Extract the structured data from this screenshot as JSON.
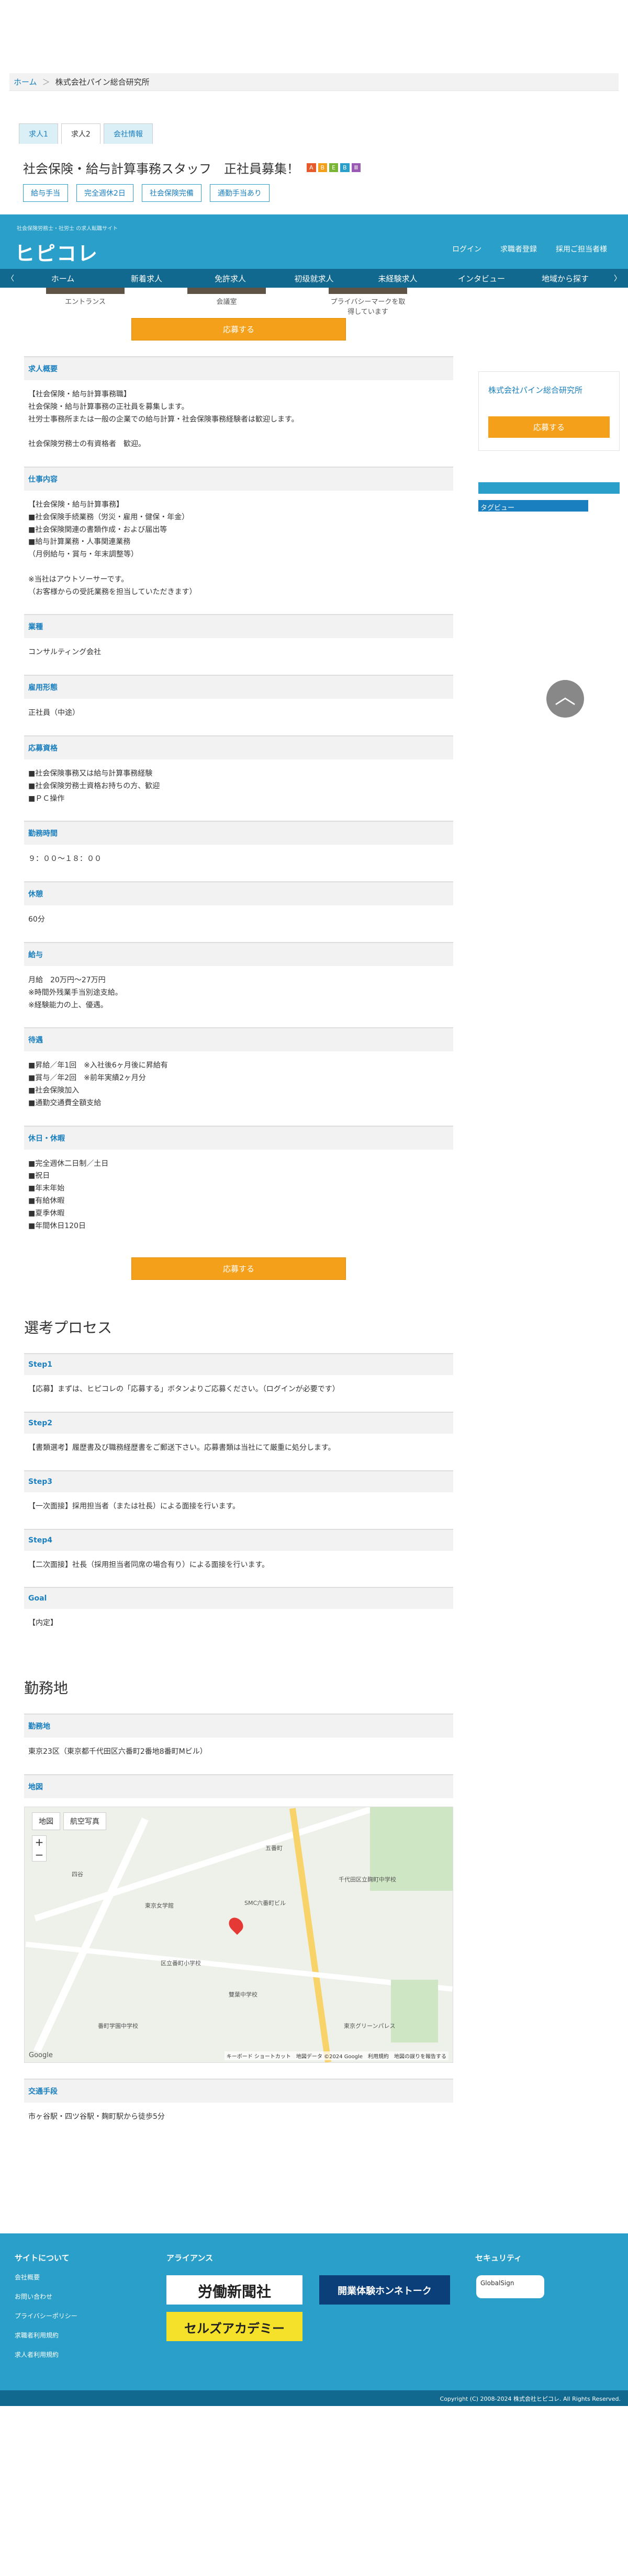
{
  "breadcrumb": {
    "home": "ホーム",
    "sep": "＞",
    "current": "株式会社パイン総合研究所"
  },
  "tabs": [
    "求人1",
    "求人2",
    "会社情報"
  ],
  "job": {
    "title": "社会保険・給与計算事務スタッフ　正社員募集！",
    "badges": [
      {
        "label": "A",
        "color": "#e65a2b"
      },
      {
        "label": "B",
        "color": "#f5a01a"
      },
      {
        "label": "E",
        "color": "#7bb536"
      },
      {
        "label": "B",
        "color": "#2a9fc9"
      },
      {
        "label": "Ⅲ",
        "color": "#9b59b6"
      }
    ],
    "tags": [
      "給与手当",
      "完全週休2日",
      "社会保険完備",
      "通勤手当あり"
    ]
  },
  "header": {
    "tagline": "社会保険労務士・社労士 の求人転職サイト",
    "logo": "ヒピコレ",
    "links": [
      "ログイン",
      "求職者登録",
      "採用ご担当者様"
    ]
  },
  "nav": {
    "prev": "〈",
    "next": "〉",
    "items": [
      "ホーム",
      "新着求人",
      "免許求人",
      "初级就求人",
      "未経験求人",
      "インタビュー",
      "地域から探す"
    ]
  },
  "photos": [
    "エントランス",
    "会議室",
    "プライバシーマークを取得しています"
  ],
  "apply_label": "応募する",
  "sections": [
    {
      "head": "求人概要",
      "body": "【社会保険・給与計算事務職】\n社会保険・給与計算事務の正社員を募集します。\n社労士事務所または一般の企業での給与計算・社会保険事務経験者は歓迎します。\n\n社会保険労務士の有資格者　歓迎。"
    },
    {
      "head": "仕事内容",
      "body": "【社会保険・給与計算事務】\n■社会保険手続業務（労災・雇用・健保・年金）\n■社会保険関連の書類作成・および届出等\n■給与計算業務・人事関連業務\n（月例給与・賞与・年末調整等）\n\n※当社はアウトソーサーです。\n（お客様からの受託業務を担当していただきます）"
    },
    {
      "head": "業種",
      "body": "コンサルティング会社"
    },
    {
      "head": "雇用形態",
      "body": "正社員（中途）"
    },
    {
      "head": "応募資格",
      "body": "■社会保険事務又は給与計算事務経験\n■社会保険労務士資格お持ちの方、歓迎\n■ＰＣ操作"
    },
    {
      "head": "勤務時間",
      "body": "９：００〜１８：００"
    },
    {
      "head": "休憩",
      "body": "60分"
    },
    {
      "head": "給与",
      "body": "月給　20万円〜27万円\n※時間外残業手当別途支給。\n※経験能力の上、優遇。"
    },
    {
      "head": "待遇",
      "body": "■昇給／年1回　※入社後6ヶ月後に昇給有\n■賞与／年2回　※前年実績2ヶ月分\n■社会保険加入\n■通勤交通費全額支給"
    },
    {
      "head": "休日・休暇",
      "body": "■完全週休二日制／土日\n■祝日\n■年末年始\n■有給休暇\n■夏季休暇\n■年間休日120日"
    }
  ],
  "selection": {
    "title": "選考プロセス",
    "steps": [
      {
        "head": "Step1",
        "body": "【応募】まずは、ヒピコレの「応募する」ボタンよりご応募ください。（ログインが必要です）"
      },
      {
        "head": "Step2",
        "body": "【書類選考】履歴書及び職務経歴書をご郵送下さい。応募書類は当社にて厳重に処分します。"
      },
      {
        "head": "Step3",
        "body": "【一次面接】採用担当者（または社長）による面接を行います。"
      },
      {
        "head": "Step4",
        "body": "【二次面接】社長（採用担当者同席の場合有り）による面接を行います。"
      },
      {
        "head": "Goal",
        "body": "【内定】"
      }
    ]
  },
  "workplace": {
    "title": "勤務地",
    "location_head": "勤務地",
    "location": "東京23区（東京都千代田区六番町2番地8番町Mビル）",
    "map_head": "地図",
    "map_btn_map": "地図",
    "map_btn_satellite": "航空写真",
    "map_zoom_in": "+",
    "map_zoom_out": "−",
    "map_labels": [
      "五番町",
      "SMC六番町ビル",
      "東京女学館",
      "区立番町小学校",
      "四谷",
      "番町学園中学校",
      "雙葉中学校",
      "千代田区立麹町中学校",
      "東京グリーンパレス"
    ],
    "map_google": "Google",
    "map_footer": "キーボード ショートカット　地図データ ©2024 Google　利用規約　地図の誤りを報告する",
    "access_head": "交通手段",
    "access": "市ヶ谷駅・四ツ谷駅・麹町駅から徒歩5分"
  },
  "side": {
    "company": "株式会社パイン総合研究所",
    "apply": "応募する",
    "bar2": "タグビュー"
  },
  "scroll_top_icon": "︿",
  "footer": {
    "site_head": "サイトについて",
    "site_links": [
      "会社概要",
      "お問い合わせ",
      "プライバシーポリシー",
      "求職者利用規約",
      "求人者利用規約"
    ],
    "alliance_head": "アライアンス",
    "alliance_logos": [
      "労働新聞社",
      "開業体験ホンネトーク",
      "セルズアカデミー"
    ],
    "security_head": "セキュリティ",
    "ssl": "GlobalSign",
    "copyright": "Copyright (C) 2008-2024 株式会社ヒピコレ. All Rights Reserved."
  }
}
